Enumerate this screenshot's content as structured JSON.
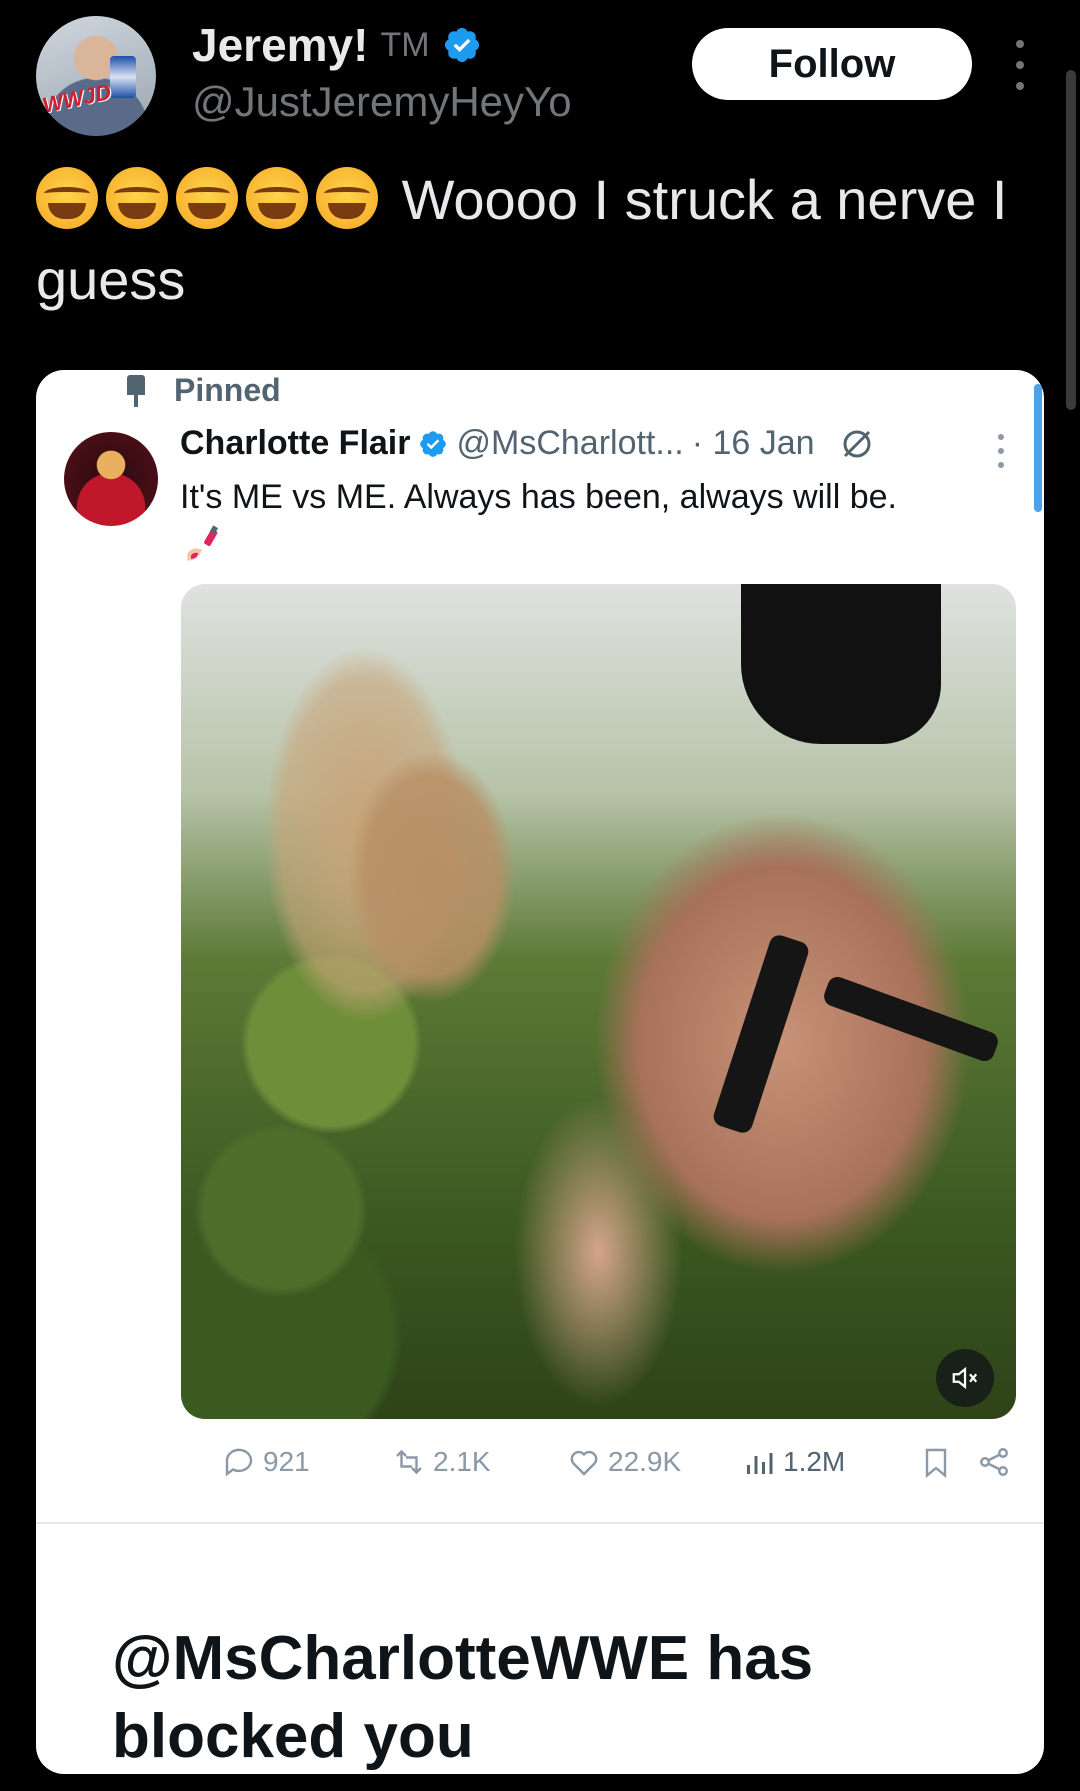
{
  "header": {
    "display_name": "Jeremy!",
    "tm": "TM",
    "handle": "@JustJeremyHeyYo",
    "avatar_text": "WWJD",
    "follow_label": "Follow"
  },
  "tweet": {
    "emoji_count": 5,
    "text": "Woooo I struck a nerve I guess"
  },
  "embedded": {
    "pinned_label": "Pinned",
    "author_name": "Charlotte Flair",
    "author_handle": "@MsCharlott...",
    "date": "· 16 Jan",
    "text": "It's ME vs ME. Always has been, always will be.",
    "actions": {
      "replies": "921",
      "reposts": "2.1K",
      "likes": "22.9K",
      "views": "1.2M"
    },
    "blocked_message": "@MsCharlotteWWE has blocked you"
  },
  "colors": {
    "background": "#000000",
    "verified_blue": "#1d9bf0",
    "muted_text": "#71767b",
    "card_bg": "#ffffff"
  },
  "icons": [
    "verified-badge-icon",
    "more-icon",
    "pin-icon",
    "grok-icon",
    "nail-polish-icon",
    "mute-icon",
    "reply-icon",
    "repost-icon",
    "like-icon",
    "views-icon",
    "bookmark-icon",
    "share-icon"
  ]
}
